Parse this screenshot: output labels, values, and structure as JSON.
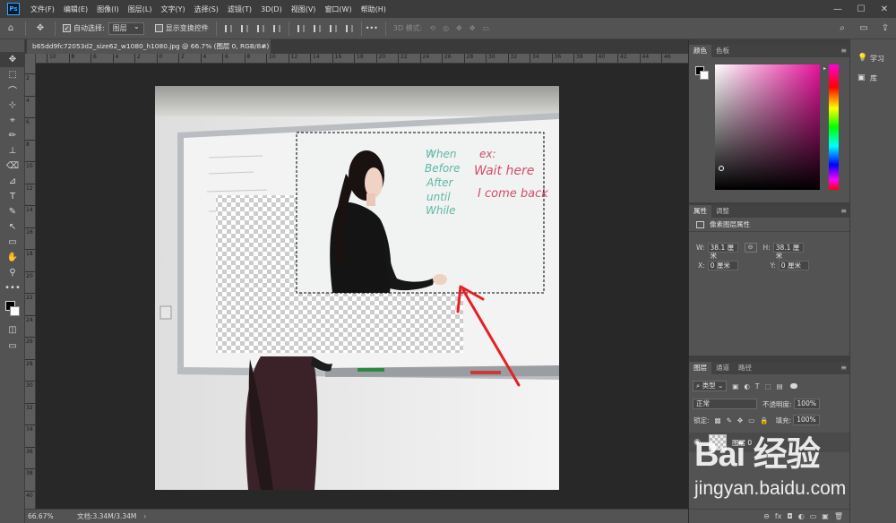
{
  "menubar": {
    "logo": "Ps",
    "items": [
      "文件(F)",
      "编辑(E)",
      "图像(I)",
      "图层(L)",
      "文字(Y)",
      "选择(S)",
      "滤镜(T)",
      "3D(D)",
      "视图(V)",
      "窗口(W)",
      "帮助(H)"
    ],
    "window_controls": [
      "—",
      "☐",
      "✕"
    ]
  },
  "options": {
    "auto_select_label": "自动选择:",
    "auto_select_target": "图层",
    "show_transform_label": "显示变换控件",
    "more": "•••",
    "mode_3d_label": "3D 模式:"
  },
  "tools": {
    "icons": [
      "✥",
      "⬚",
      "⌒",
      "⊹",
      "⌖",
      "✏",
      "⊥",
      "⌫",
      "⊿",
      "T",
      "✎",
      "↖",
      "▭",
      "✋",
      "⚲",
      "•••"
    ]
  },
  "document": {
    "tab_title": "b65dd9fc72053d2_size62_w1080_h1080.jpg @ 66.7% (图层 0, RGB/8#) *",
    "close": "×"
  },
  "ruler": {
    "top_labels": [
      "10",
      "8",
      "6",
      "4",
      "2",
      "0",
      "2",
      "4",
      "6",
      "8",
      "10",
      "12",
      "14",
      "16",
      "18",
      "20",
      "22",
      "24",
      "26",
      "28",
      "30",
      "32",
      "34",
      "36",
      "38",
      "40",
      "42",
      "44",
      "46"
    ],
    "left_labels": [
      "2",
      "4",
      "6",
      "8",
      "10",
      "12",
      "14",
      "16",
      "18",
      "20",
      "22",
      "24",
      "26",
      "28",
      "30",
      "32",
      "34",
      "36",
      "38",
      "40"
    ]
  },
  "whiteboard": {
    "left_words": [
      "When",
      "Before",
      "After",
      "until",
      "While"
    ],
    "right_words": [
      "ex:",
      "Wait here",
      "I come back"
    ]
  },
  "status": {
    "zoom": "66.67%",
    "doc_size": "文档:3.34M/3.34M",
    "arrow": "›"
  },
  "color_panel": {
    "tabs": [
      "颜色",
      "色板"
    ],
    "hue_marker": "▸"
  },
  "props_panel": {
    "tabs": [
      "属性",
      "调整"
    ],
    "subtitle": "像素图层属性",
    "w_label": "W:",
    "w_value": "38.1 厘米",
    "h_label": "H:",
    "h_value": "38.1 厘米",
    "x_label": "X:",
    "x_value": "0 厘米",
    "y_label": "Y:",
    "y_value": "0 厘米",
    "link": "⊖"
  },
  "layers_panel": {
    "tabs": [
      "图层",
      "通道",
      "路径"
    ],
    "kind_filter": "类型",
    "blend_mode": "正常",
    "opacity_label": "不透明度:",
    "opacity_value": "100%",
    "lock_label": "锁定:",
    "fill_label": "填充:",
    "fill_value": "100%",
    "layer_name": "图层 0",
    "footer_icons": [
      "⊖",
      "fx",
      "◘",
      "◐",
      "▭",
      "▣",
      "🗑"
    ]
  },
  "dock": {
    "learn": "学习",
    "library": "库"
  },
  "watermark": {
    "brand": "Bai 经验",
    "domain": "jingyan.baidu.com"
  }
}
